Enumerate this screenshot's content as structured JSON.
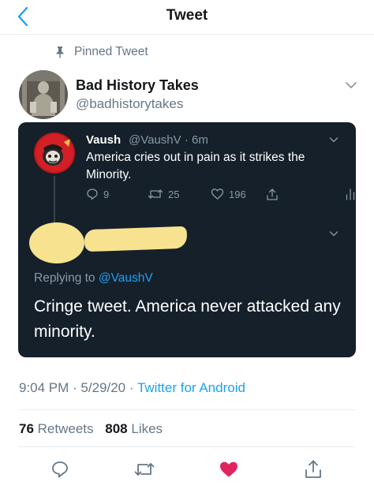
{
  "header": {
    "title": "Tweet",
    "back_icon": "chevron-left-icon"
  },
  "pinned": {
    "label": "Pinned Tweet",
    "icon": "pin-icon"
  },
  "author": {
    "name": "Bad History Takes",
    "handle": "@badhistorytakes"
  },
  "quoted": {
    "name": "Vaush",
    "meta": "@VaushV · 6m",
    "text": "America cries out in pain as it strikes the Minority.",
    "replies": "9",
    "retweets": "25",
    "likes": "196"
  },
  "reply": {
    "replying_prefix": "Replying to",
    "replying_mention": "@VaushV",
    "text": "Cringe tweet. America never attacked any minority."
  },
  "meta": {
    "time": "9:04 PM · 5/29/20 · ",
    "source": "Twitter for Android"
  },
  "stats": {
    "retweets_count": "76",
    "retweets_label": "Retweets",
    "likes_count": "808",
    "likes_label": "Likes"
  },
  "colors": {
    "accent": "#1da1f2",
    "like_active": "#e0245e",
    "card_bg": "#15202b",
    "redaction": "#f7e38f"
  }
}
